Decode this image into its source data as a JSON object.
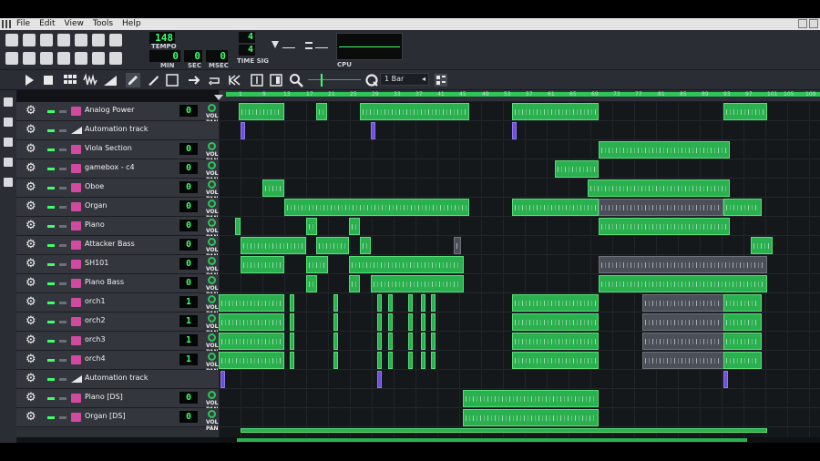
{
  "menu": [
    "File",
    "Edit",
    "View",
    "Tools",
    "Help"
  ],
  "transport": {
    "tempo": "148",
    "tempo_label": "TEMPO",
    "min": "0",
    "min_label": "MIN",
    "sec": "0",
    "sec_label": "SEC",
    "msec": "0",
    "msec_label": "MSEC",
    "timesig_num": "4",
    "timesig_den": "4",
    "timesig_label": "TIME SIG",
    "cpu_label": "CPU"
  },
  "zoom": {
    "value": "1 Bar"
  },
  "ruler": [
    "1",
    "9",
    "13",
    "17",
    "21",
    "25",
    "29",
    "33",
    "37",
    "41",
    "45",
    "49",
    "53",
    "57",
    "61",
    "65",
    "69",
    "73",
    "77",
    "81",
    "85",
    "89",
    "93",
    "97",
    "101",
    "105",
    "109"
  ],
  "vol_pan_label": "VOL PAN",
  "tracks": [
    {
      "name": "Analog Power",
      "type": "inst",
      "vol": "0"
    },
    {
      "name": "Automation track",
      "type": "auto"
    },
    {
      "name": "Viola Section",
      "type": "inst",
      "vol": "0"
    },
    {
      "name": "gamebox - c4",
      "type": "inst",
      "vol": "0"
    },
    {
      "name": "Oboe",
      "type": "inst",
      "vol": "0"
    },
    {
      "name": "Organ",
      "type": "inst",
      "vol": "0"
    },
    {
      "name": "Piano",
      "type": "inst",
      "vol": "0"
    },
    {
      "name": "Attacker Bass",
      "type": "inst",
      "vol": "0"
    },
    {
      "name": "SH101",
      "type": "inst",
      "vol": "0"
    },
    {
      "name": "Piano Bass",
      "type": "inst",
      "vol": "0"
    },
    {
      "name": "orch1",
      "type": "inst",
      "vol": "1"
    },
    {
      "name": "orch2",
      "type": "inst",
      "vol": "1"
    },
    {
      "name": "orch3",
      "type": "inst",
      "vol": "1"
    },
    {
      "name": "orch4",
      "type": "inst",
      "vol": "1"
    },
    {
      "name": "Automation track",
      "type": "auto"
    },
    {
      "name": "Piano [DS]",
      "type": "inst",
      "vol": "0"
    },
    {
      "name": "Organ [DS]",
      "type": "inst",
      "vol": "0"
    }
  ],
  "icons": {
    "gear": "gear-icon",
    "play": "play-icon",
    "stop": "stop-icon",
    "pencil": "pencil-icon",
    "magnifier": "magnifier-icon",
    "quantize": "q-icon"
  },
  "colors": {
    "clip": "#2bb04f",
    "clip_muted": "#4b5058",
    "automation": "#6d4fd8",
    "lcd": "#3cff6a",
    "instrument_icon": "#d04aa0"
  }
}
